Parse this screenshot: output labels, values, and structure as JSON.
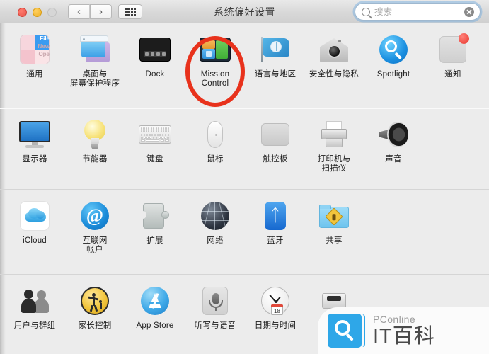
{
  "window": {
    "title": "系统偏好设置",
    "traffic_lights": [
      "close",
      "minimize",
      "maximize"
    ],
    "nav": {
      "back": "‹",
      "forward": "›",
      "grid": "grid-view"
    },
    "search": {
      "placeholder": "搜索",
      "value": "",
      "clear": "×"
    }
  },
  "accent_colors": {
    "annotation_red": "#e8321c",
    "window_bg": "#ececec",
    "titlebar_bg": "#d8d8d8",
    "focus_ring": "#6eaae1",
    "watermark_blue": "#2ea7e8"
  },
  "rows": [
    {
      "items": [
        {
          "label": "通用",
          "icon": "general-icon",
          "icon_text": {
            "file": "File",
            "new": "New",
            "open": "Ope"
          }
        },
        {
          "label": "桌面与\n屏幕保护程序",
          "icon": "desktop-screensaver-icon"
        },
        {
          "label": "Dock",
          "icon": "dock-icon"
        },
        {
          "label": "Mission\nControl",
          "icon": "mission-control-icon",
          "highlighted": true
        },
        {
          "label": "语言与地区",
          "icon": "language-region-icon"
        },
        {
          "label": "安全性与隐私",
          "icon": "security-privacy-icon"
        },
        {
          "label": "Spotlight",
          "icon": "spotlight-icon"
        },
        {
          "label": "通知",
          "icon": "notifications-icon"
        }
      ]
    },
    {
      "items": [
        {
          "label": "显示器",
          "icon": "displays-icon"
        },
        {
          "label": "节能器",
          "icon": "energy-saver-icon"
        },
        {
          "label": "键盘",
          "icon": "keyboard-icon"
        },
        {
          "label": "鼠标",
          "icon": "mouse-icon"
        },
        {
          "label": "触控板",
          "icon": "trackpad-icon"
        },
        {
          "label": "打印机与\n扫描仪",
          "icon": "printers-scanners-icon"
        },
        {
          "label": "声音",
          "icon": "sound-icon"
        }
      ]
    },
    {
      "items": [
        {
          "label": "iCloud",
          "icon": "icloud-icon"
        },
        {
          "label": "互联网\n帐户",
          "icon": "internet-accounts-icon"
        },
        {
          "label": "扩展",
          "icon": "extensions-icon"
        },
        {
          "label": "网络",
          "icon": "network-icon"
        },
        {
          "label": "蓝牙",
          "icon": "bluetooth-icon"
        },
        {
          "label": "共享",
          "icon": "sharing-icon"
        }
      ]
    },
    {
      "items": [
        {
          "label": "用户与群组",
          "icon": "users-groups-icon"
        },
        {
          "label": "家长控制",
          "icon": "parental-controls-icon"
        },
        {
          "label": "App Store",
          "icon": "app-store-icon"
        },
        {
          "label": "听写与语音",
          "icon": "dictation-speech-icon"
        },
        {
          "label": "日期与时间",
          "icon": "date-time-icon"
        },
        {
          "label": "",
          "icon": "time-machine-icon"
        }
      ]
    }
  ],
  "watermark": {
    "brand": "PConline",
    "name": "IT百科"
  }
}
